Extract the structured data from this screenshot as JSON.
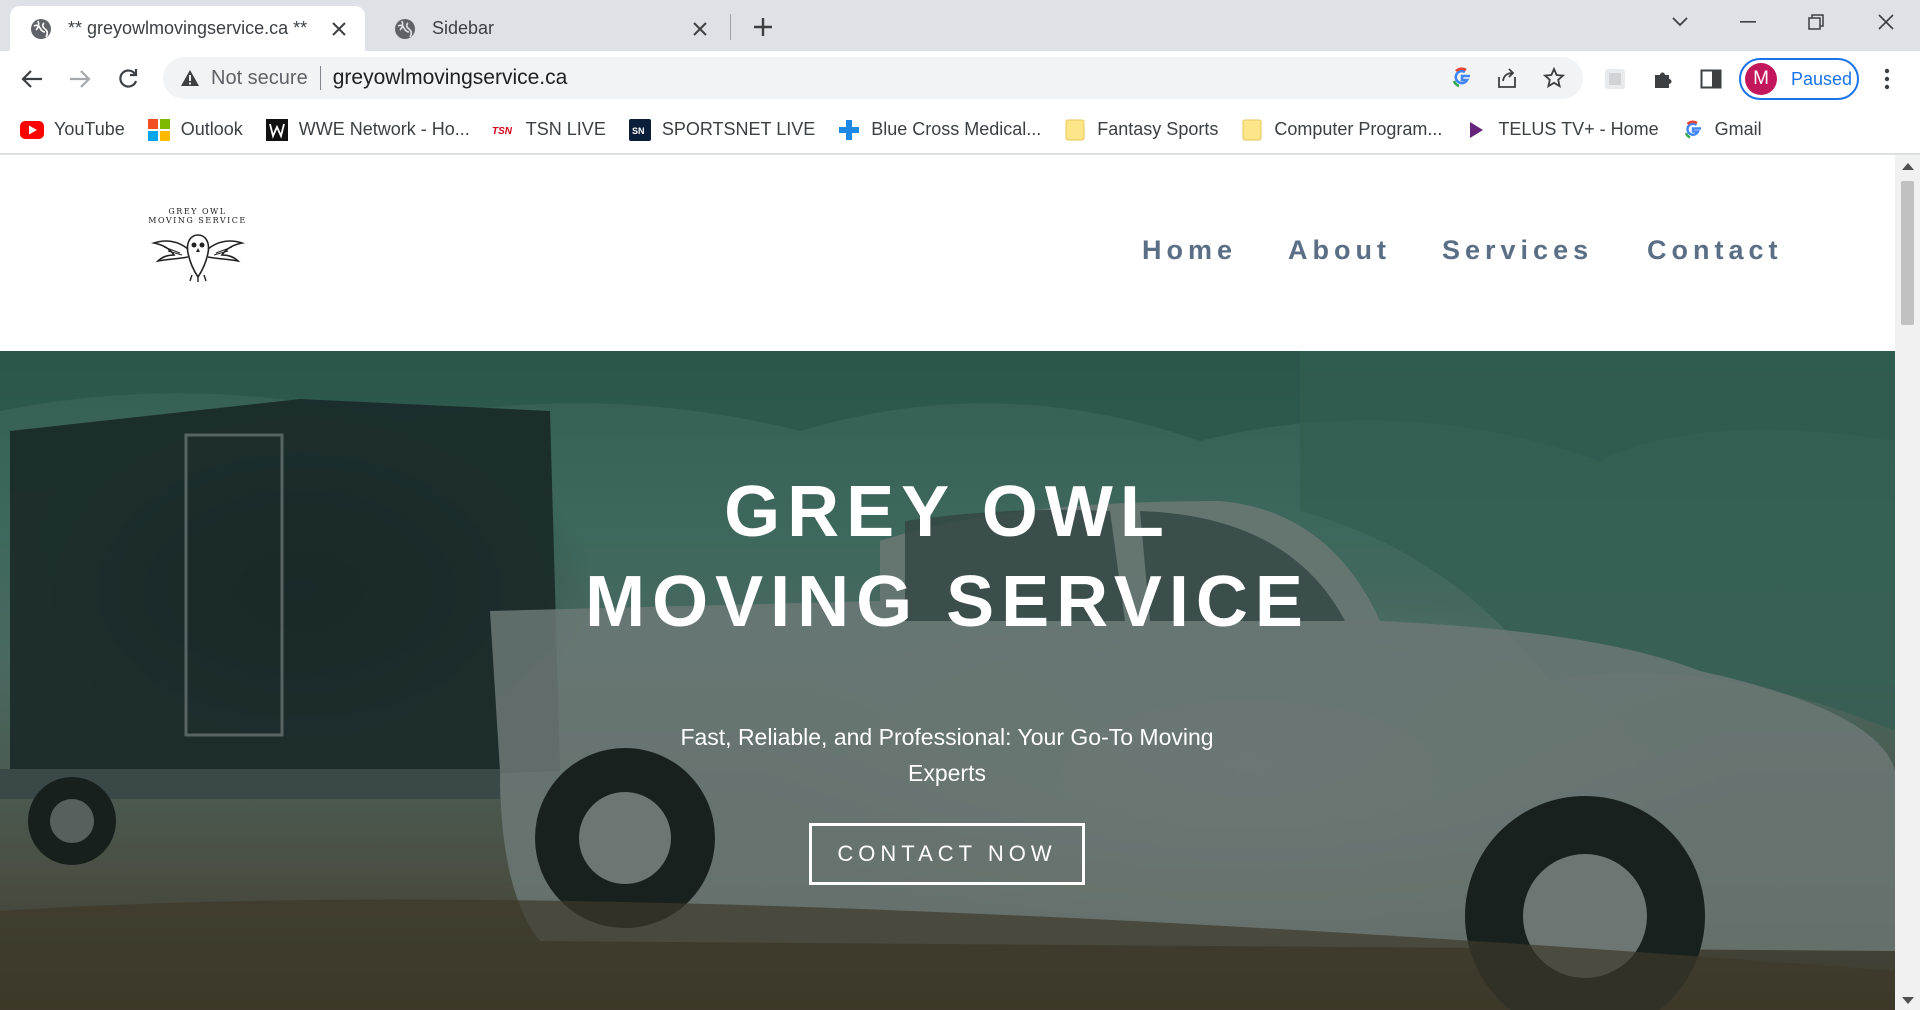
{
  "browser": {
    "tabs": [
      {
        "title": "** greyowlmovingservice.ca **",
        "active": true
      },
      {
        "title": "Sidebar",
        "active": false
      }
    ],
    "security_label": "Not secure",
    "url": "greyowlmovingservice.ca",
    "profile_initial": "M",
    "profile_status": "Paused",
    "bookmarks": [
      {
        "label": "YouTube",
        "icon": "youtube-icon"
      },
      {
        "label": "Outlook",
        "icon": "outlook-icon"
      },
      {
        "label": "WWE Network - Ho...",
        "icon": "wwe-icon"
      },
      {
        "label": "TSN LIVE",
        "icon": "tsn-icon"
      },
      {
        "label": "SPORTSNET LIVE",
        "icon": "sportsnet-icon"
      },
      {
        "label": "Blue Cross Medical...",
        "icon": "blue-cross-icon"
      },
      {
        "label": "Fantasy Sports",
        "icon": "folder-icon"
      },
      {
        "label": "Computer Program...",
        "icon": "folder-icon"
      },
      {
        "label": "TELUS TV+ - Home",
        "icon": "telus-play-icon"
      },
      {
        "label": "Gmail",
        "icon": "google-icon"
      }
    ]
  },
  "site": {
    "logo_line1": "GREY OWL",
    "logo_line2": "MOVING SERVICE",
    "nav": [
      "Home",
      "About",
      "Services",
      "Contact"
    ],
    "hero_title_line1": "GREY OWL",
    "hero_title_line2": "MOVING SERVICE",
    "hero_subtitle": "Fast, Reliable, and Professional: Your Go-To Moving Experts",
    "hero_button": "CONTACT NOW"
  }
}
